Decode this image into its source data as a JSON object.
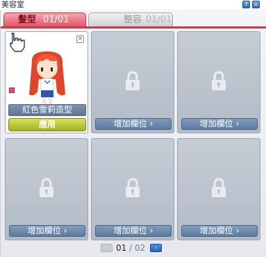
{
  "window": {
    "title": "美容室",
    "help_label": "?",
    "close_label": "×"
  },
  "tabs": [
    {
      "label": "髮型",
      "count": "01/01",
      "active": true
    },
    {
      "label": "整容",
      "count": "01/01",
      "active": false
    }
  ],
  "character_slot": {
    "name": "紅色雪莉造型",
    "apply_label": "應用",
    "delete_label": "×"
  },
  "locked_slots": [
    {
      "label": "增加欄位",
      "chevron": "›"
    },
    {
      "label": "增加欄位",
      "chevron": "›"
    },
    {
      "label": "增加欄位",
      "chevron": "›"
    },
    {
      "label": "增加欄位",
      "chevron": "›"
    },
    {
      "label": "增加欄位",
      "chevron": "›"
    }
  ],
  "pager": {
    "current": "01",
    "separator": "/",
    "total": "02",
    "prev_label": "‹",
    "next_label": "›"
  },
  "icons": {
    "lock": "lock-icon",
    "cursor": "hand-cursor-icon"
  },
  "colors": {
    "accent": "#c93a4a",
    "apply": "#a2b224",
    "locked_bg": "#b8c0cb"
  }
}
